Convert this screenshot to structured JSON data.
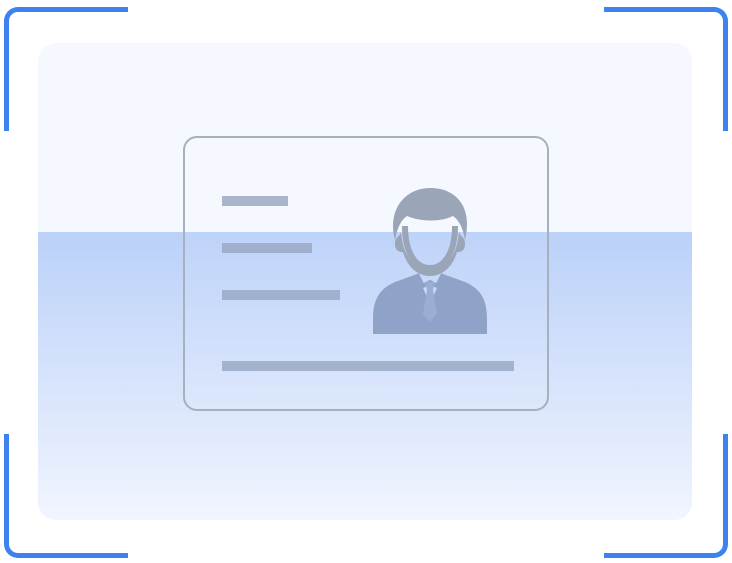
{
  "scanner": {
    "corner_color": "#3d82f0",
    "panel_color": "#f5f8fe",
    "scan_band_color": "#bbd1f9"
  },
  "id_card": {
    "icon": "id-card-icon",
    "portrait_icon": "person-silhouette-icon",
    "border_color": "#a7b0bf",
    "placeholder_line_color": "#9aa9c4"
  }
}
